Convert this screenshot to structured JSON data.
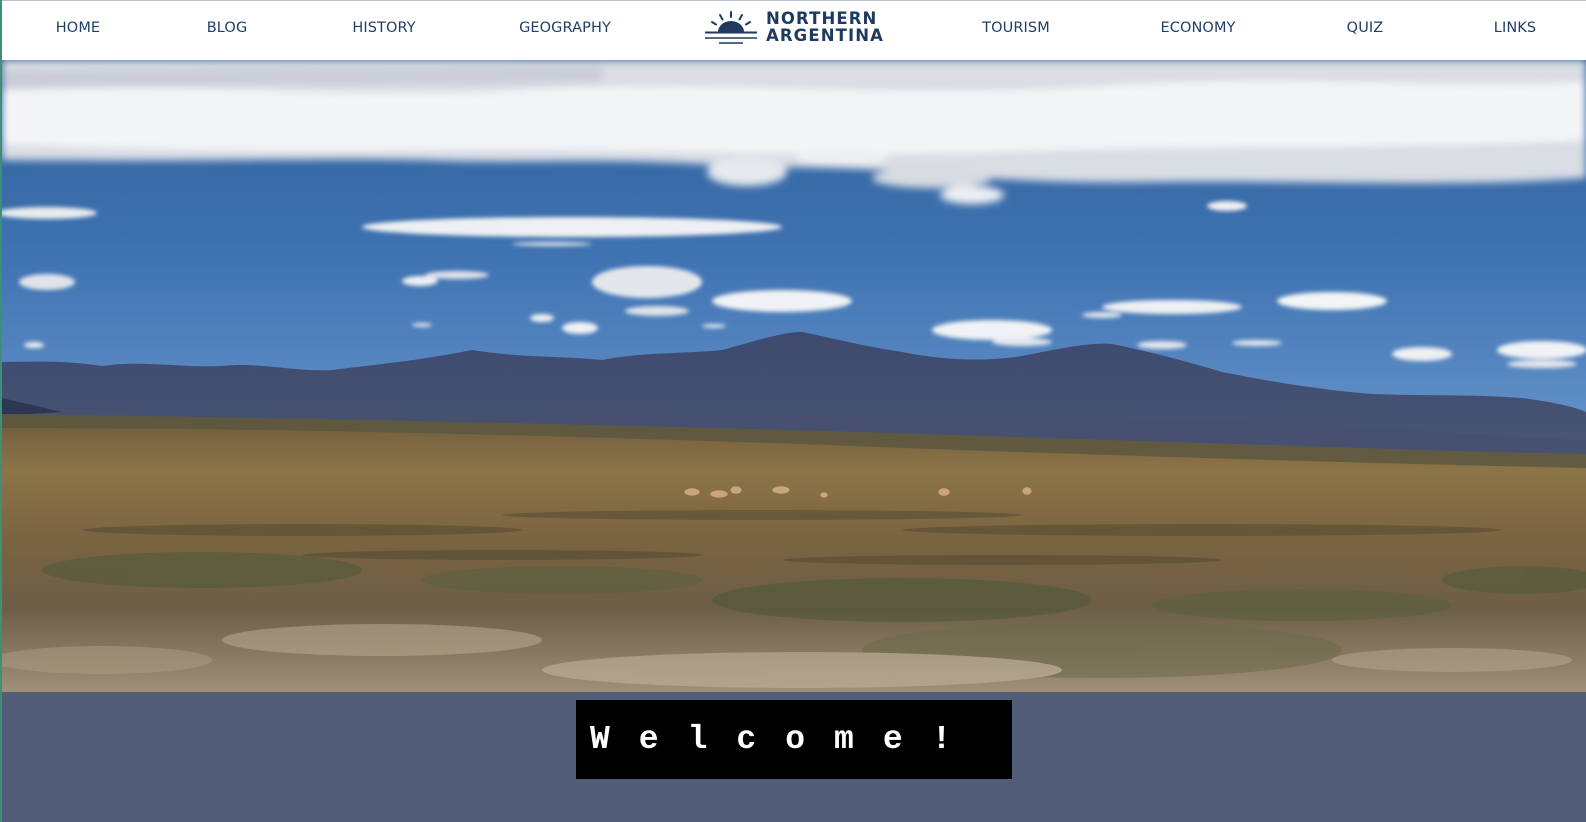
{
  "nav": {
    "left_items": [
      {
        "label": "HOME"
      },
      {
        "label": "BLOG"
      },
      {
        "label": "HISTORY"
      },
      {
        "label": "GEOGRAPHY"
      }
    ],
    "right_items": [
      {
        "label": "TOURISM"
      },
      {
        "label": "ECONOMY"
      },
      {
        "label": "QUIZ"
      },
      {
        "label": "LINKS"
      }
    ],
    "logo": {
      "line1": "NORTHERN",
      "line2": "ARGENTINA",
      "icon": "rising-sun-icon"
    }
  },
  "hero": {
    "icon": "landscape-photo",
    "scene": "Andean altiplano with grazing vicuñas, mountains and cloudy blue sky"
  },
  "welcome": {
    "text": "Welcome!"
  },
  "colors": {
    "nav_text": "#1e3f66",
    "logo_text": "#1f3a5f",
    "band": "#525d78",
    "welcome_bg": "#000000",
    "welcome_text": "#ffffff"
  }
}
